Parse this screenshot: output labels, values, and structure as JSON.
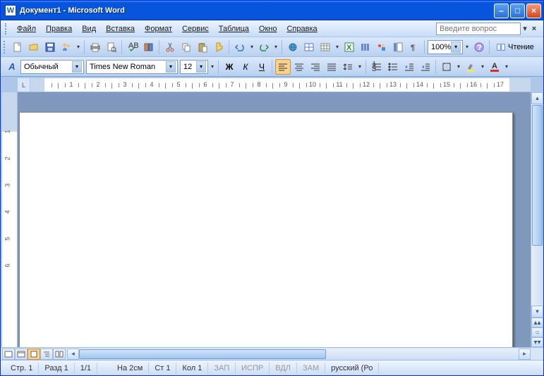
{
  "titlebar": {
    "title": "Документ1 - Microsoft Word",
    "appicon": "W"
  },
  "menu": {
    "items": [
      "Файл",
      "Правка",
      "Вид",
      "Вставка",
      "Формат",
      "Сервис",
      "Таблица",
      "Окно",
      "Справка"
    ],
    "ask_placeholder": "Введите вопрос"
  },
  "toolbar1": {
    "zoom": "100%",
    "read_label": "Чтение"
  },
  "toolbar2": {
    "style": "Обычный",
    "font": "Times New Roman",
    "size": "12",
    "bold": "Ж",
    "italic": "К",
    "underline": "Ч"
  },
  "ruler": {
    "corner": "L",
    "max": 17
  },
  "status": {
    "page": "Стр. 1",
    "section": "Разд 1",
    "pages": "1/1",
    "at": "На 2см",
    "line": "Ст 1",
    "col": "Кол 1",
    "rec": "ЗАП",
    "trk": "ИСПР",
    "ext": "ВДЛ",
    "ovr": "ЗАМ",
    "lang": "русский (Ро"
  }
}
